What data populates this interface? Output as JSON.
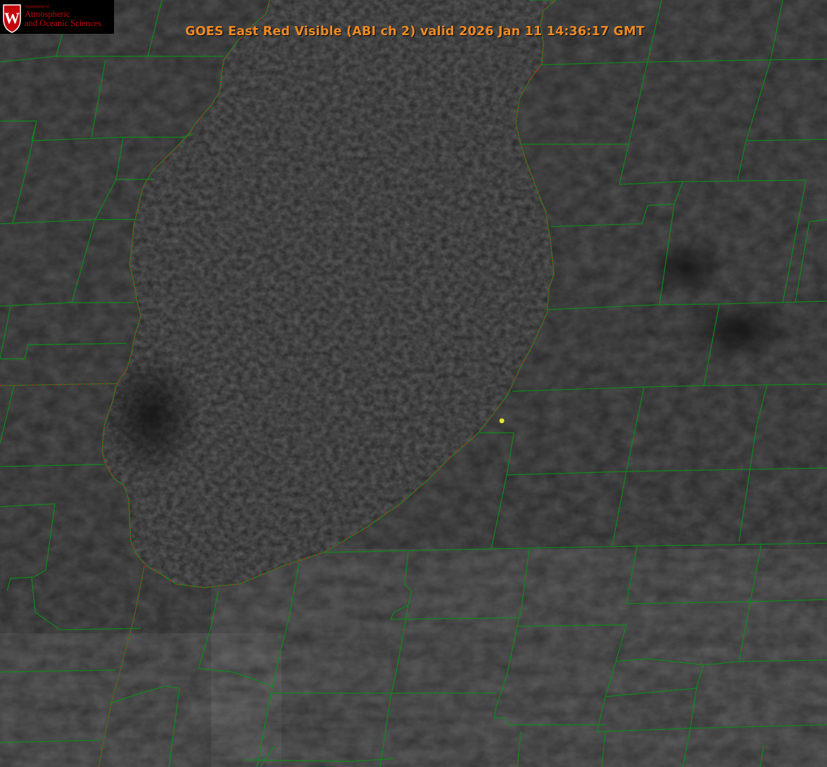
{
  "title": "GOES East Red Visible (ABI ch 2) valid 2026 Jan 11 14:36:17 GMT",
  "logo": {
    "line_small_1": "Department of",
    "line_big_1": "Atmospheric",
    "line_big_2": "and Oceanic Sciences",
    "shield_letter": "W"
  },
  "colors": {
    "background": "#262626",
    "lake": "#242424",
    "county_lines": "#0f8a1a",
    "shoreline": "#0f8a1a",
    "state_line": "#d22020",
    "title_text": "#f08a24",
    "marker": "#e3e81e",
    "logo_red": "#c5050c"
  },
  "icons": {
    "logo": "uw-crest-icon",
    "marker": "point-marker-icon"
  }
}
